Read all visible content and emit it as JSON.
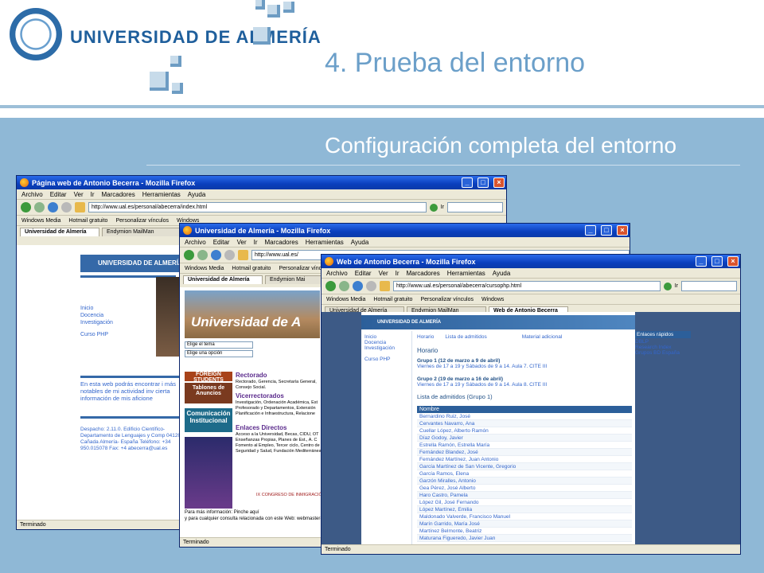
{
  "slide": {
    "logo_text": "UNIVERSIDAD DE ALMERÍA",
    "title": "4. Prueba del entorno",
    "subtitle": "Configuración completa del entorno"
  },
  "colors": {
    "accent": "#6b9fc9",
    "body_bg": "#8fb8d6",
    "xp_title": "#0a3fbd"
  },
  "menu": [
    "Archivo",
    "Editar",
    "Ver",
    "Ir",
    "Marcadores",
    "Herramientas",
    "Ayuda"
  ],
  "win1": {
    "title": "Página web de Antonio Becerra - Mozilla Firefox",
    "url": "http://www.ual.es/personal/abecerra/index.html",
    "bookmarks": [
      "Windows Media",
      "Hotmail gratuito",
      "Personalizar vínculos",
      "Windows"
    ],
    "tabs": [
      "Universidad de Almería",
      "Endymion MailMan"
    ],
    "page": {
      "logo": "UNIVERSIDAD DE ALMERÍA",
      "nav": [
        "Inicio",
        "Docencia",
        "Investigación",
        "Curso PHP"
      ],
      "intro": "En esta web podrás encontrar i más notables de mi actividad inv cierta información de mis aficione",
      "addr": "Despacho: 2.11.0. Edificio Científico- Departamento de Lenguajes y Comp 04120. La Cañada Almería- España Teléfono: +34 950.015078 Fax: +4 abecerra@ual.es"
    },
    "status": "Terminado"
  },
  "win2": {
    "title": "Universidad de Almería - Mozilla Firefox",
    "url": "http://www.ual.es/",
    "bookmarks": [
      "Windows Media",
      "Hotmail gratuito",
      "Personalizar vínculos"
    ],
    "tabs": [
      "Universidad de Almería",
      "Endymion Mai"
    ],
    "page": {
      "banner": "Universidad de A",
      "select1": "Elige el tema",
      "select2": "Elige una opción",
      "foreign": "FOREIGN STUDENTS",
      "tablones": "Tablones de Anuncios",
      "comunicacion": "Comunicación Institucional",
      "rectorado": "Rectorado",
      "rectorado_txt": "Rectorado, Gerencia, Secretaría General, Consejo Social.",
      "vicerrectorados": "Vicerrectorados",
      "vicerrectorados_txt": "Investigación, Ordenación Académica, Est Profesorado y Departamentos, Extensión Planificación e Infraestructura, Relacione",
      "enlaces": "Enlaces Directos",
      "enlaces_txt": "Acceso a la Universidad, Becas, CIDU, OT Enseñanzas Propias, Planes de Est., A. C Fomento al Empleo, Tercer ciclo, Centro de Seguridad y Salud, Fundación Mediterránea",
      "congreso": "IX CONGRESO DE INMIGRACIÓN",
      "foot1": "Para más información: Pinche aquí",
      "foot2": "y para cualquier consulta relacionada con este Web: webmaster@"
    },
    "status": "Terminado"
  },
  "win3": {
    "title": "Web de Antonio Becerra - Mozilla Firefox",
    "url": "http://www.ual.es/personal/abecerra/cursophp.html",
    "bookmarks": [
      "Windows Media",
      "Hotmail gratuito",
      "Personalizar vínculos",
      "Windows"
    ],
    "tabs": [
      "Universidad de Almería",
      "Endymion MailMan",
      "Web de Antonio Becerra"
    ],
    "page": {
      "header": "UNIVERSIDAD DE ALMERÍA",
      "nav": [
        "Inicio",
        "Docencia",
        "Investigación",
        "Curso PHP"
      ],
      "menu": [
        "Horario",
        "Lista de admitidos",
        "Material adicional"
      ],
      "horario_title": "Horario",
      "grupo1_title": "Grupo 1 (12 de marzo a 9 de abril)",
      "grupo1_desc": "Viernes de 17 a 19 y Sábados de 9 a 14. Aula 7. CITE III",
      "grupo2_title": "Grupo 2 (19 de marzo a 16 de abril)",
      "grupo2_desc": "Viernes de 17 a 19 y Sábados de 9 a 14. Aula 8. CITE III",
      "lista_title": "Lista de admitidos (Grupo 1)",
      "table_header": "Nombre",
      "names": [
        "Bernardino Ruiz, José",
        "Cervantes Navarro, Ana",
        "Cuellar López, Alberto Ramón",
        "Díaz Godoy, Javier",
        "Estrella Ramón, Estrella María",
        "Fernández Blandez, José",
        "Fernández Martínez, Juan Antonio",
        "García Martínez de San Vicente, Gregorio",
        "García Ramos, Elena",
        "Garzón Miralles, Antonio",
        "Gea Pérez, José Alberto",
        "Haro Castro, Pamela",
        "López Gil, José Fernando",
        "López Martínez, Emilia",
        "Maldonado Valverde, Francisco Manuel",
        "Marín Garrido, María José",
        "Martínez Belmonte, Beatriz",
        "Maturana Figueredo, Javier Juan"
      ],
      "quick_title": "Enlaces rápidos",
      "quick": [
        "DBLP",
        "Research Index",
        "Grupos BD España"
      ]
    },
    "status": "Terminado"
  }
}
